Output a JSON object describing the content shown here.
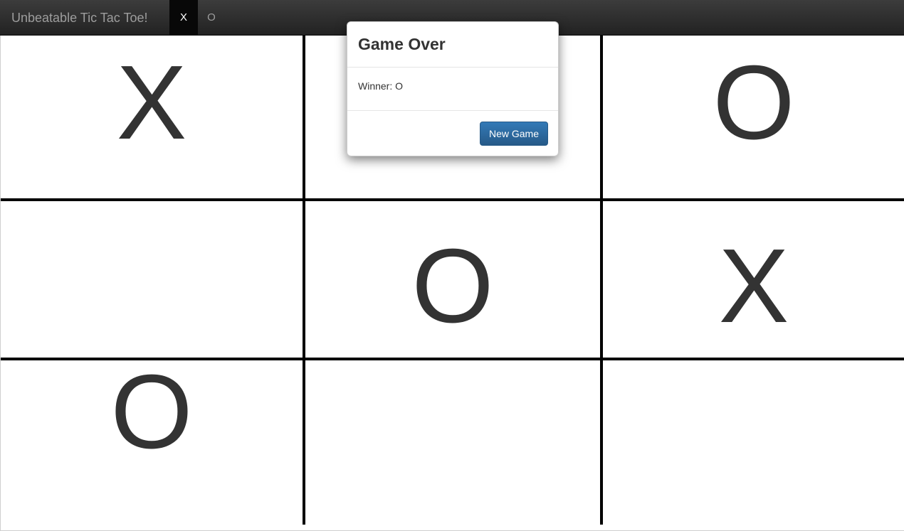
{
  "navbar": {
    "brand": "Unbeatable Tic Tac Toe!",
    "tabs": [
      {
        "label": "X",
        "active": true
      },
      {
        "label": "O",
        "active": false
      }
    ]
  },
  "board": {
    "cells": [
      "X",
      "",
      "O",
      "",
      "O",
      "X",
      "O",
      "",
      ""
    ]
  },
  "modal": {
    "title": "Game Over",
    "message": "Winner: O",
    "button_label": "New Game"
  },
  "colors": {
    "navbar_bg": "#222222",
    "mark": "#333333",
    "grid": "#000000",
    "primary_button": "#337ab7"
  }
}
